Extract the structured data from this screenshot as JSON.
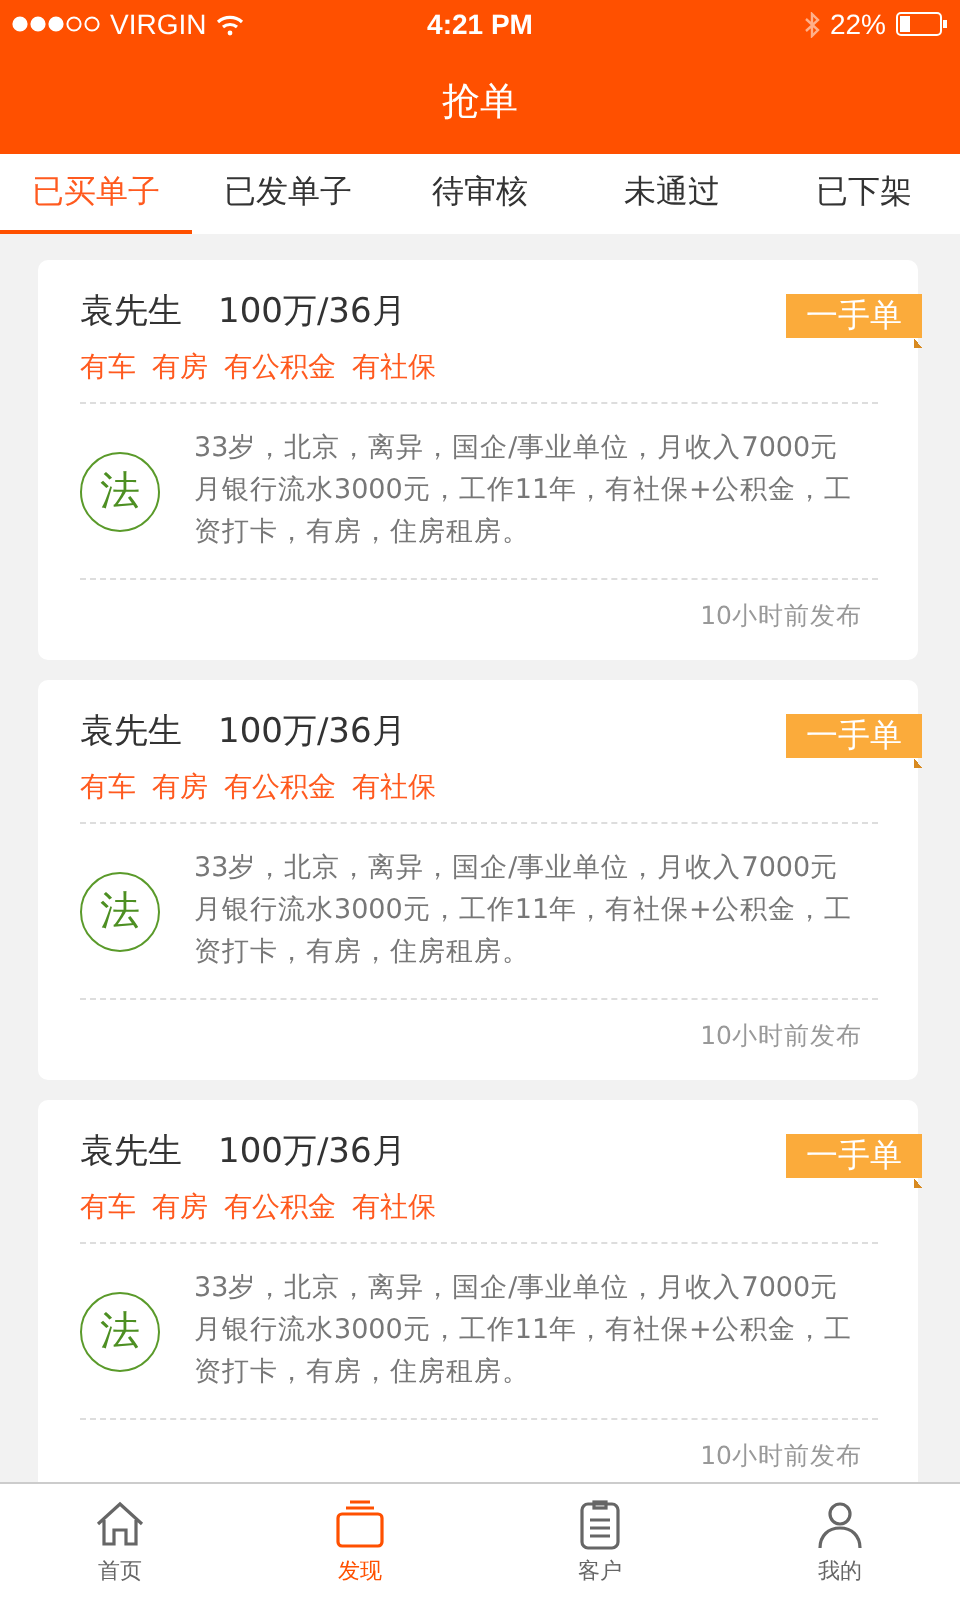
{
  "status_bar": {
    "carrier": "VIRGIN",
    "time": "4:21 PM",
    "battery": "22%"
  },
  "header": {
    "title": "抢单"
  },
  "tabs": [
    {
      "label": "已买单子",
      "selected": true
    },
    {
      "label": "已发单子",
      "selected": false
    },
    {
      "label": "待审核",
      "selected": false
    },
    {
      "label": "未通过",
      "selected": false
    },
    {
      "label": "已下架",
      "selected": false
    }
  ],
  "orders": [
    {
      "name": "袁先生",
      "amount": "100万/36月",
      "badge": "一手单",
      "tags": [
        "有车",
        "有房",
        "有公积金",
        "有社保"
      ],
      "seal": "法",
      "description": "33岁，北京，离异，国企/事业单位，月收入7000元月银行流水3000元，工作11年，有社保+公积金，工资打卡，有房，住房租房。",
      "posted": "10小时前发布"
    },
    {
      "name": "袁先生",
      "amount": "100万/36月",
      "badge": "一手单",
      "tags": [
        "有车",
        "有房",
        "有公积金",
        "有社保"
      ],
      "seal": "法",
      "description": "33岁，北京，离异，国企/事业单位，月收入7000元月银行流水3000元，工作11年，有社保+公积金，工资打卡，有房，住房租房。",
      "posted": "10小时前发布"
    },
    {
      "name": "袁先生",
      "amount": "100万/36月",
      "badge": "一手单",
      "tags": [
        "有车",
        "有房",
        "有公积金",
        "有社保"
      ],
      "seal": "法",
      "description": "33岁，北京，离异，国企/事业单位，月收入7000元月银行流水3000元，工作11年，有社保+公积金，工资打卡，有房，住房租房。",
      "posted": "10小时前发布"
    }
  ],
  "tab_bar": [
    {
      "kind": "home",
      "label": "首页",
      "selected": false
    },
    {
      "kind": "discover",
      "label": "发现",
      "selected": true
    },
    {
      "kind": "clients",
      "label": "客户",
      "selected": false
    },
    {
      "kind": "me",
      "label": "我的",
      "selected": false
    }
  ]
}
